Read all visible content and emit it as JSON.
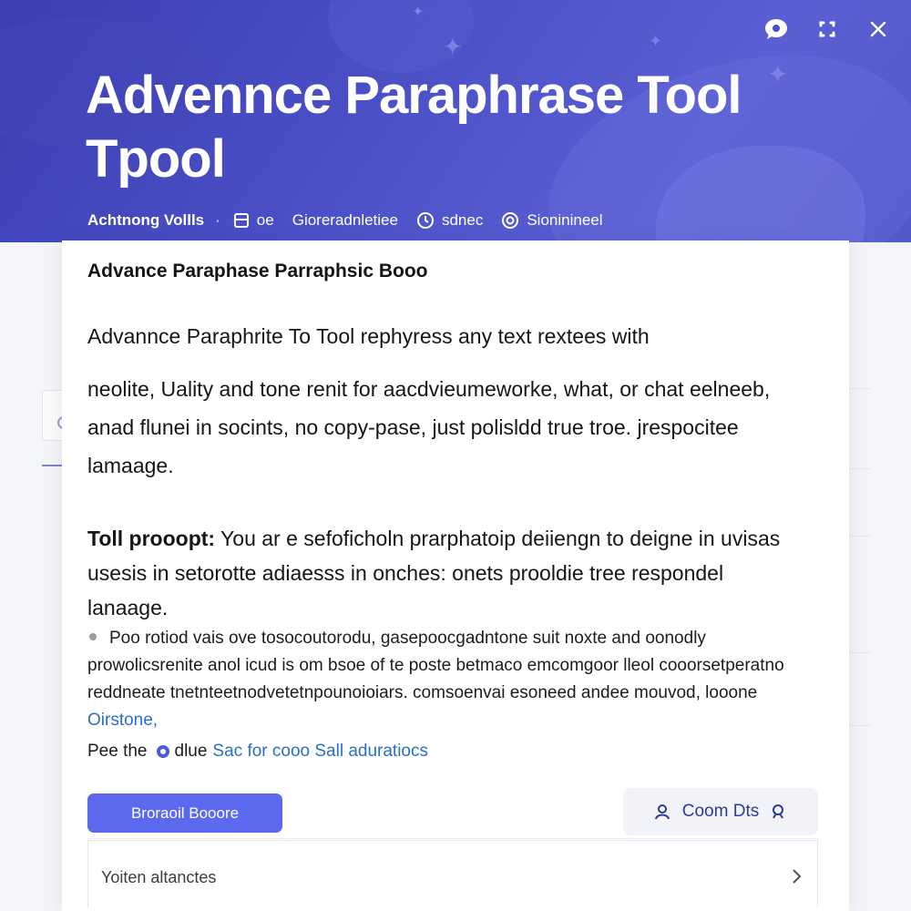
{
  "header": {
    "title_line1": "Advennce Paraphrase Tool",
    "title_line2": "Tpool",
    "meta": {
      "title": "Achtnong Vollls",
      "separator": "·",
      "item1": "oe",
      "item2": "Gioreradnletiee",
      "item3": "sdnec",
      "item4": "Sioninineel"
    }
  },
  "window_controls": {
    "icons": [
      "chat-bubble-icon",
      "expand-icon",
      "close-icon"
    ]
  },
  "card": {
    "heading": "Advance Paraphase Parraphsic Booo",
    "para1_line1": "Advannce Paraphrite To Tool rephyress any text rextees with",
    "para1_rest": "neolite, Uality and tone renit for aacdvieumeworke, what, or chat eelneeb, anad flunei in socints, no copy-pase, just polisldd true troe. jrespocitee lamaage.",
    "para2_label": "Toll prooopt:",
    "para2_text": " You ar e sefoficholn prarphatoip deiiengn to deigne in uvisas usesis in setorotte adiaesss in onches: onets prooldie tree respondel lanaage.",
    "bullet_text": "Poo rotiod vais ove tosocoutorodu, gasepoocgadntone suit noxte and oonodly prowolicsrenite anol icud is om bsoe of te poste betmaco emcomgoor lleol cooorsetperatno reddneate tnetnteetnodvetetnpounoioiars. comsoenvai esoneed andee mouvod, looone",
    "bullet_link": "Oirstone,",
    "note_prefix": "Pee the",
    "note_option": "dlue",
    "note_link": "Sac for cooo Sall aduratiocs",
    "primary_button": "Broraoil Booore",
    "secondary_button": "Coom Dts",
    "list_row_label": "Yoiten altanctes"
  },
  "colors": {
    "hero_start": "#3b3fb1",
    "hero_end": "#5a60d3",
    "primary": "#5b69ef",
    "link": "#2a6fc7"
  }
}
